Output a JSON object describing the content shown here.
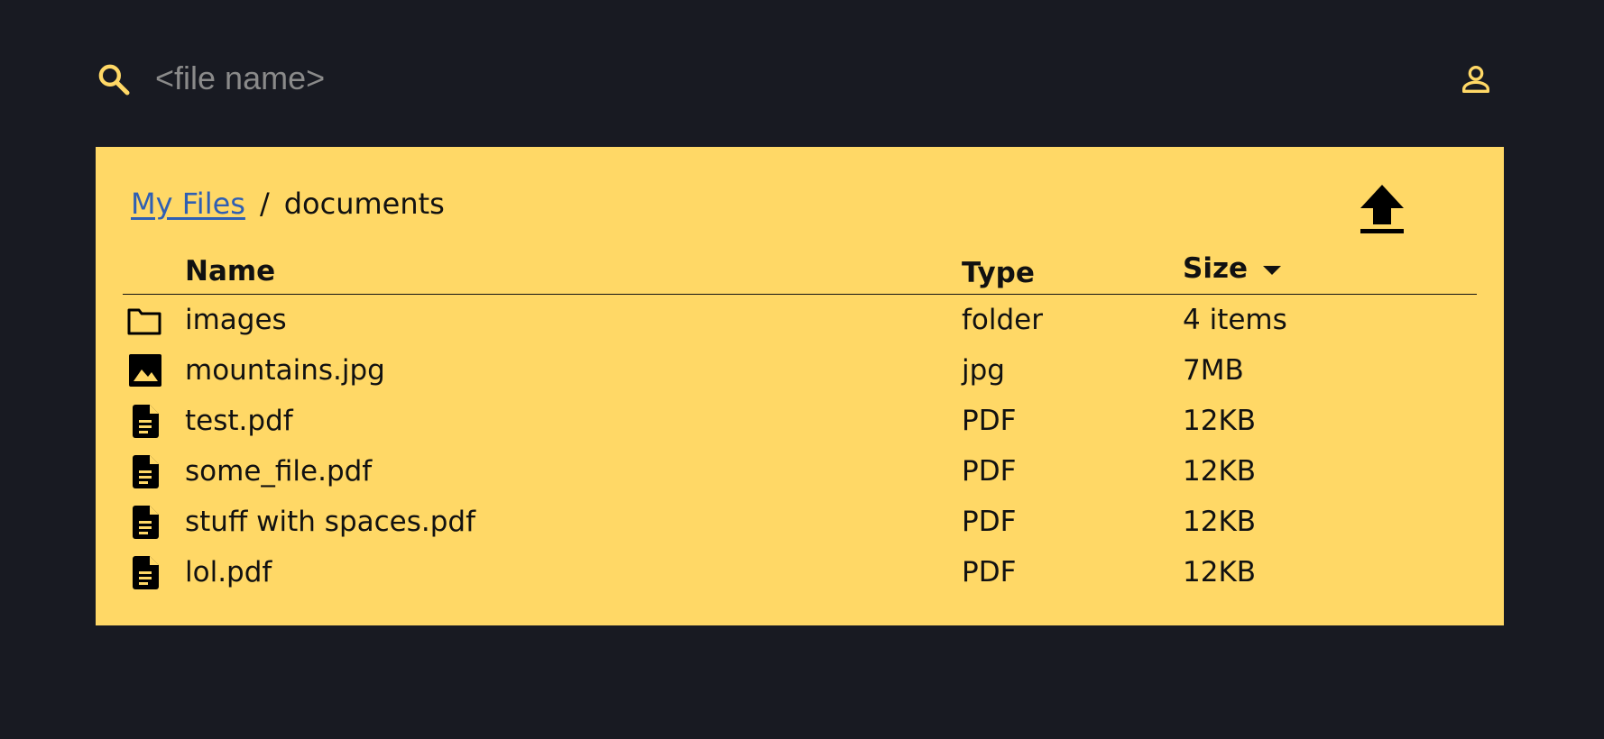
{
  "colors": {
    "background": "#181a22",
    "panel": "#ffd866",
    "accent": "#ffd866",
    "link": "#2f5fb3",
    "text": "#111111"
  },
  "search": {
    "icon": "search-icon",
    "placeholder": "<file name>",
    "value": ""
  },
  "account": {
    "icon": "user-icon"
  },
  "breadcrumb": {
    "root_label": "My Files",
    "separator": "/",
    "current": "documents"
  },
  "upload": {
    "icon": "upload-icon"
  },
  "table": {
    "headers": {
      "name": "Name",
      "type": "Type",
      "size": "Size"
    },
    "sort": {
      "column": "size",
      "direction": "descending",
      "icon": "caret-down-icon"
    },
    "rows": [
      {
        "icon": "folder-icon",
        "name": "images",
        "type": "folder",
        "size": "4 items"
      },
      {
        "icon": "image-icon",
        "name": "mountains.jpg",
        "type": "jpg",
        "size": "7MB"
      },
      {
        "icon": "document-icon",
        "name": "test.pdf",
        "type": "PDF",
        "size": "12KB"
      },
      {
        "icon": "document-icon",
        "name": "some_file.pdf",
        "type": "PDF",
        "size": "12KB"
      },
      {
        "icon": "document-icon",
        "name": "stuff with spaces.pdf",
        "type": "PDF",
        "size": "12KB"
      },
      {
        "icon": "document-icon",
        "name": "lol.pdf",
        "type": "PDF",
        "size": "12KB"
      }
    ]
  }
}
